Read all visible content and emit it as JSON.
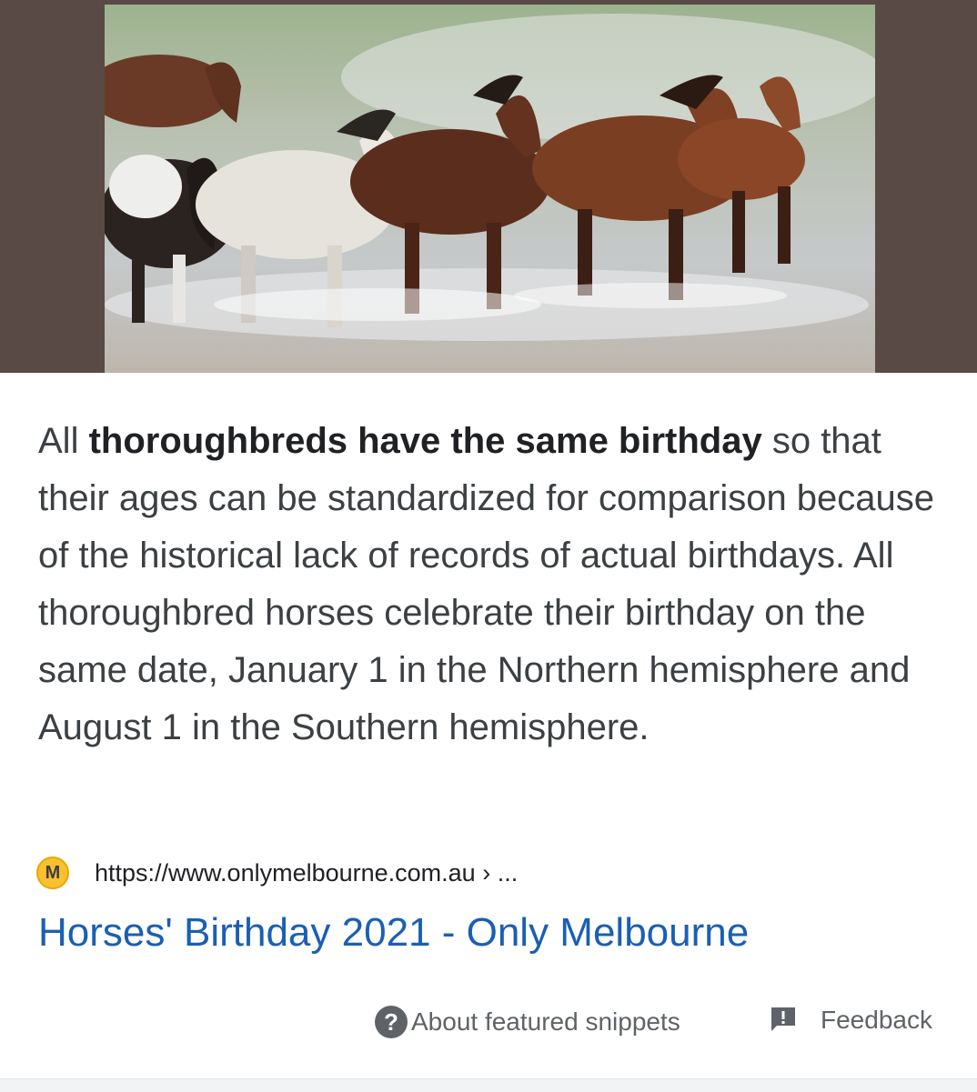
{
  "image": {
    "subject": "horses-running-through-water",
    "colors": {
      "frame": "#5a4a45",
      "sky": "#8fa78a",
      "water": "#c9cbcc"
    }
  },
  "snippet": {
    "part1": "All ",
    "bold": "thoroughbreds have the same birthday",
    "part2": " so that their ages can be standardized for comparison because of the historical lack of records of actual birthdays. All thoroughbred horses celebrate their birthday on the same date, January 1 in the Northern hemisphere and August 1 in the Southern hemisphere."
  },
  "source": {
    "favicon_letter": "M",
    "url": "https://www.onlymelbourne.com.au › ..."
  },
  "result": {
    "title": "Horses' Birthday 2021 - Only Melbourne"
  },
  "footer": {
    "about_icon": "?",
    "about_label": "About featured snippets",
    "feedback_label": "Feedback"
  },
  "colors": {
    "link": "#1a5fb4",
    "text": "#3c4043",
    "muted": "#5f6368",
    "favicon": "#fbc02d"
  }
}
